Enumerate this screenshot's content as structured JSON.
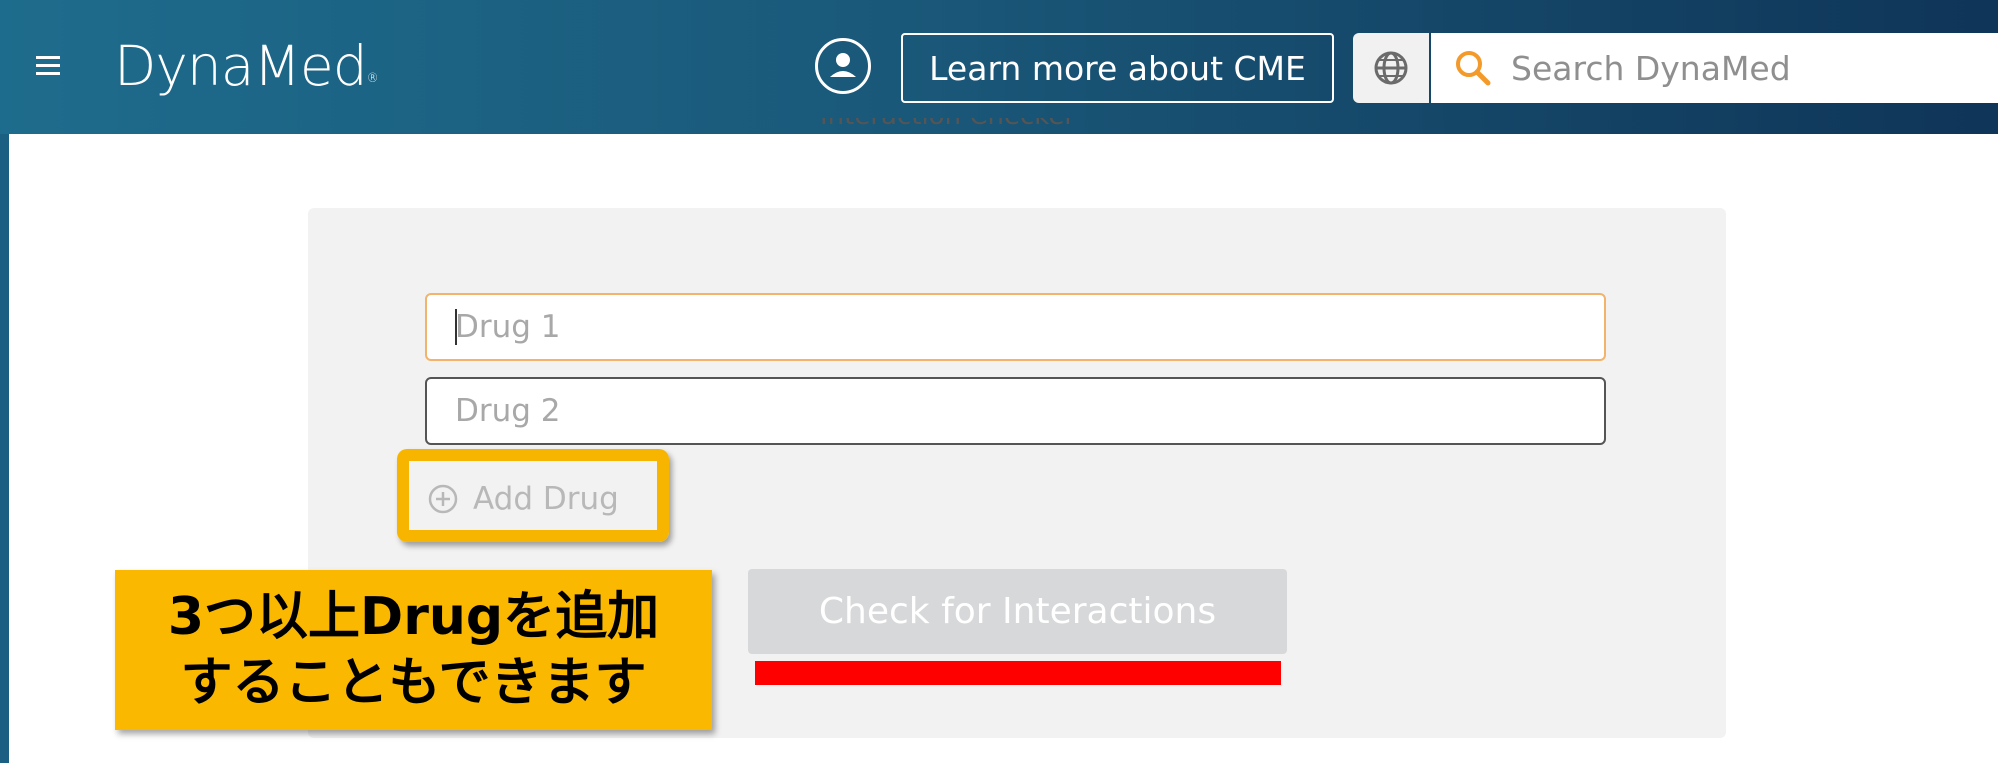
{
  "header": {
    "logo_text": "DynaMed",
    "logo_mark": "®",
    "menu_icon": "hamburger-menu-icon",
    "user_icon": "user-account-icon",
    "cme_label": "Learn more about CME",
    "language_icon": "globe-icon",
    "search_icon": "search-icon",
    "search_placeholder": "Search DynaMed"
  },
  "page": {
    "clipped_heading": "Interaction Checker"
  },
  "form": {
    "drug1_placeholder": "Drug 1",
    "drug2_placeholder": "Drug 2",
    "add_drug_icon": "plus-circle-icon",
    "add_drug_label": "Add Drug",
    "check_button_label": "Check for Interactions"
  },
  "annotation": {
    "callout_line1": "3つ以上Drugを追加",
    "callout_line2": "することもできます",
    "highlight_color": "#f8b500",
    "underline_color": "#ff0000"
  },
  "colors": {
    "header_start": "#1e6c8d",
    "header_end": "#0f3558",
    "focus_border": "#f3b36b",
    "accent_orange": "#f39a2b"
  }
}
